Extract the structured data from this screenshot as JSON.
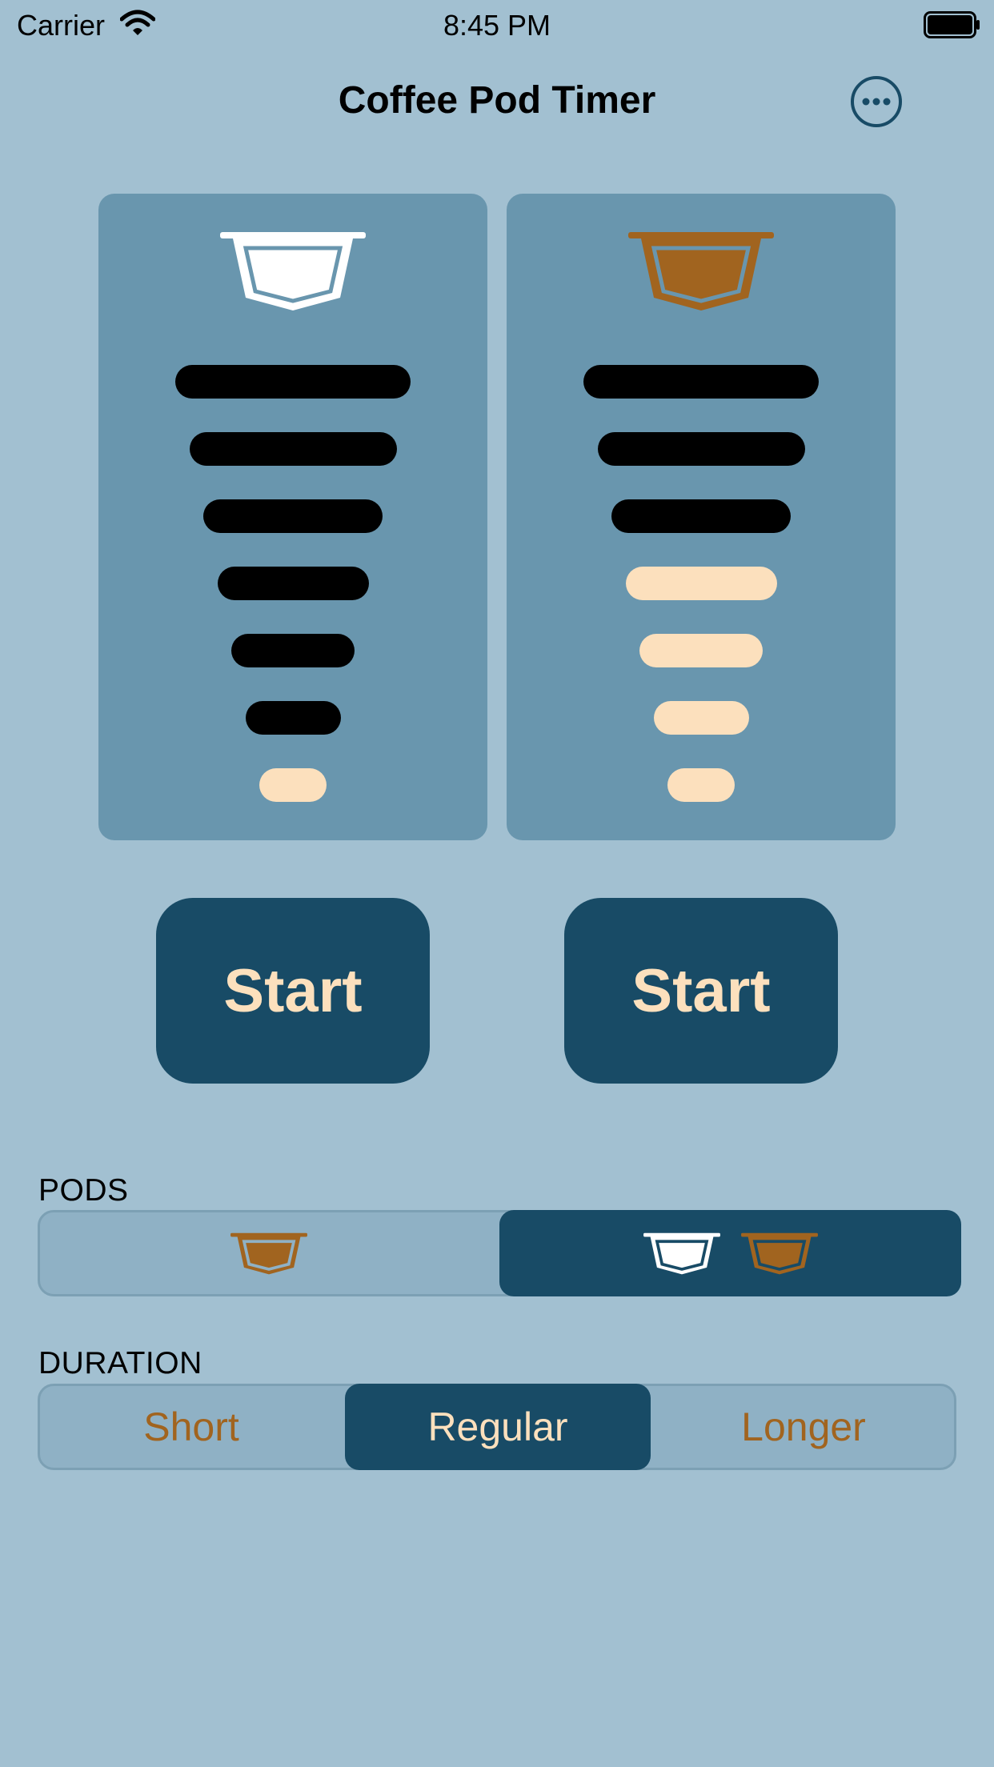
{
  "status_bar": {
    "carrier": "Carrier",
    "time": "8:45 PM"
  },
  "nav": {
    "title": "Coffee Pod Timer",
    "more_icon": "ellipsis-circle-icon"
  },
  "timers": [
    {
      "pod_icon": "white-pod-icon",
      "bars_total": 7,
      "bars_remaining": 6,
      "start_label": "Start"
    },
    {
      "pod_icon": "brown-pod-icon",
      "bars_total": 7,
      "bars_remaining": 3,
      "start_label": "Start"
    }
  ],
  "pods": {
    "label": "PODS",
    "options": [
      {
        "icons": [
          "brown-pod-icon"
        ],
        "selected": false
      },
      {
        "icons": [
          "white-pod-icon",
          "brown-pod-icon"
        ],
        "selected": true
      }
    ]
  },
  "duration": {
    "label": "DURATION",
    "options": [
      {
        "label": "Short",
        "selected": false
      },
      {
        "label": "Regular",
        "selected": true
      },
      {
        "label": "Longer",
        "selected": false
      }
    ]
  },
  "colors": {
    "background": "#a2c0d1",
    "panel": "#6996ae",
    "accent_dark": "#184b66",
    "cream": "#fce0bd",
    "brown": "#a1641f",
    "bar_filled": "#000000"
  }
}
